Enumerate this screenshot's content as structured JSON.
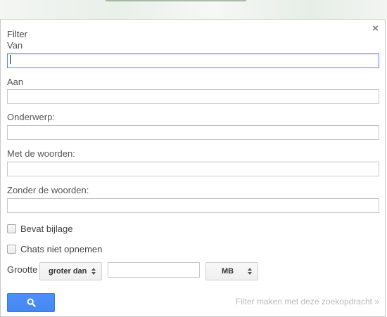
{
  "dialog": {
    "title": "Filter",
    "close_glyph": "×",
    "fields": [
      {
        "label": "Van",
        "value": ""
      },
      {
        "label": "Aan",
        "value": ""
      },
      {
        "label": "Onderwerp:",
        "value": ""
      },
      {
        "label": "Met de woorden:",
        "value": ""
      },
      {
        "label": "Zonder de woorden:",
        "value": ""
      }
    ],
    "checkboxes": [
      {
        "label": "Bevat bijlage",
        "checked": false
      },
      {
        "label": "Chats niet opnemen",
        "checked": false
      }
    ],
    "size": {
      "label": "Grootte",
      "operator": "groter dan",
      "value": "",
      "unit": "MB"
    },
    "search_icon": "search-icon",
    "create_filter_link": "Filter maken met deze zoekopdracht »"
  },
  "colors": {
    "primary_button": "#4d90fe",
    "focus_border": "#4d90fe",
    "link_disabled": "#bbbbbb"
  }
}
